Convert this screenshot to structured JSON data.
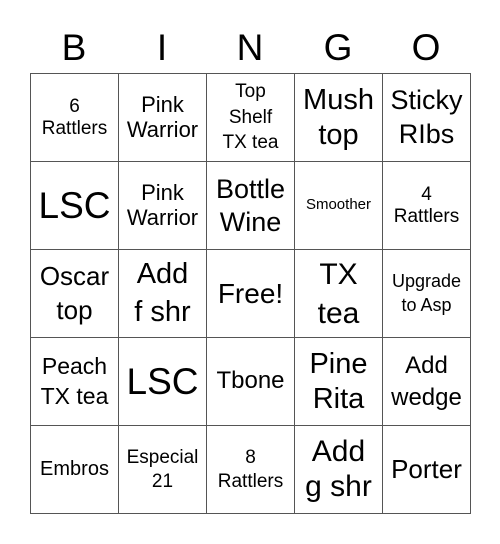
{
  "header": [
    "B",
    "I",
    "N",
    "G",
    "O"
  ],
  "cells": [
    [
      "6\nRattlers",
      "Pink\nWarrior",
      "Top\nShelf\nTX tea",
      "Mush\ntop",
      "Sticky\nRIbs"
    ],
    [
      "LSC",
      "Pink\nWarrior",
      "Bottle\nWine",
      "Smoother",
      "4\nRattlers"
    ],
    [
      "Oscar\ntop",
      "Add\nf shr",
      "Free!",
      "TX\ntea",
      "Upgrade\nto Asp"
    ],
    [
      "Peach\nTX tea",
      "LSC",
      "Tbone",
      "Pine\nRita",
      "Add\nwedge"
    ],
    [
      "Embros",
      "Especial\n21",
      "8\nRattlers",
      "Add\ng shr",
      "Porter"
    ]
  ]
}
